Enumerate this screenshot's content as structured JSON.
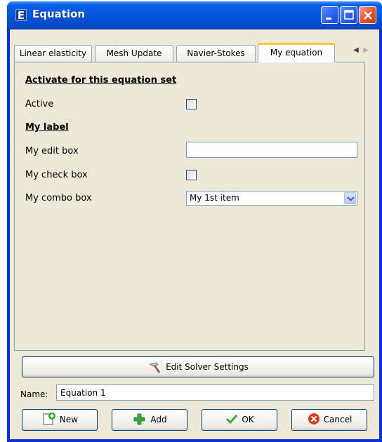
{
  "window": {
    "title": "Equation",
    "app_icon_letter": "E"
  },
  "tabs": [
    {
      "label": "Linear elasticity",
      "active": false
    },
    {
      "label": "Mesh Update",
      "active": false
    },
    {
      "label": "Navier-Stokes",
      "active": false
    },
    {
      "label": "My equation",
      "active": true
    }
  ],
  "tab_scroll": {
    "left": "◀",
    "right": "▶"
  },
  "panel": {
    "activate_heading": "Activate for this equation set",
    "active_label": "Active",
    "my_label_heading": "My label",
    "edit_box_label": "My edit box",
    "edit_box_value": "",
    "check_box_label": "My check box",
    "combo_box_label": "My combo box",
    "combo_box_value": "My 1st item"
  },
  "solver_button": "Edit Solver Settings",
  "name": {
    "label": "Name:",
    "value": "Equation 1"
  },
  "buttons": {
    "new": "New",
    "add": "Add",
    "ok": "OK",
    "cancel": "Cancel"
  },
  "colors": {
    "titlebar": "#0654d8",
    "client_bg": "#ece9d8",
    "active_tab_accent": "#ffc73c",
    "close_button": "#e2522e"
  }
}
